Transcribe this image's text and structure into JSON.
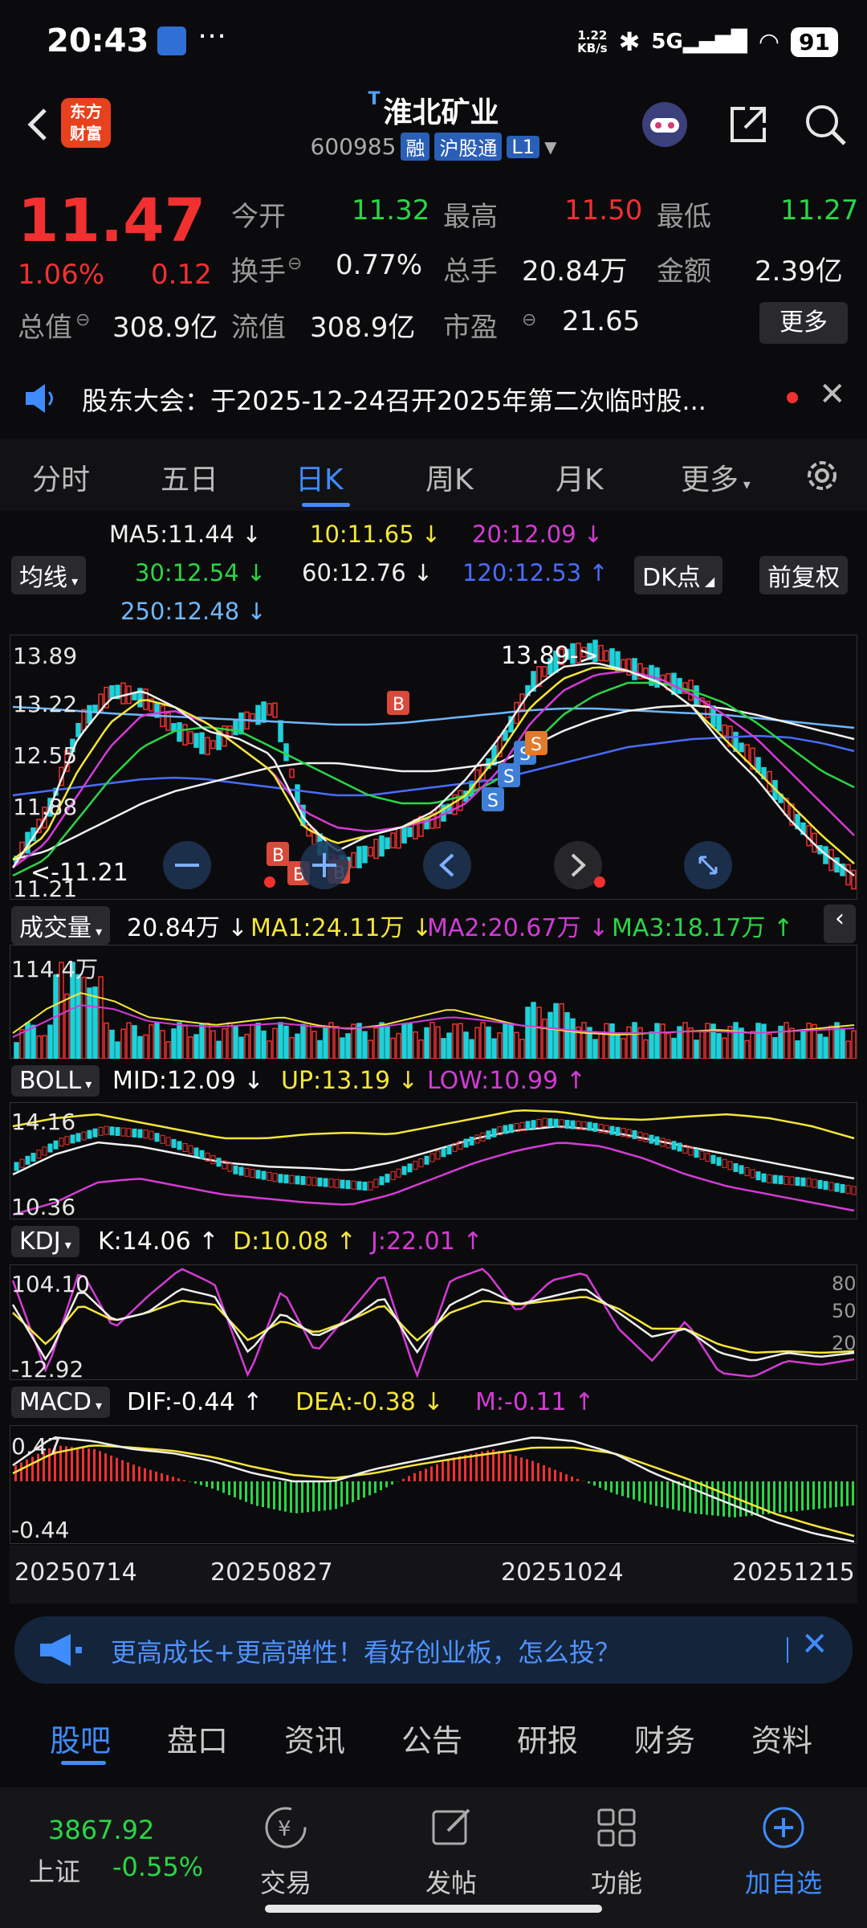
{
  "status_bar": {
    "time": "20:43",
    "net_speed_value": "1.22",
    "net_speed_unit": "KB/s",
    "network": "5G",
    "battery": "91"
  },
  "header": {
    "logo": "东方财富",
    "title": "淮北矿业",
    "title_prefix": "T",
    "code": "600985",
    "tags": [
      "融",
      "沪股通",
      "L1"
    ]
  },
  "quote": {
    "price": "11.47",
    "change_pct": "1.06%",
    "change": "0.12",
    "fields": [
      {
        "label": "今开",
        "value": "11.32",
        "color": "green"
      },
      {
        "label": "最高",
        "value": "11.50",
        "color": "red"
      },
      {
        "label": "最低",
        "value": "11.27",
        "color": "green"
      },
      {
        "label": "换手",
        "value": "0.77%",
        "color": "white"
      },
      {
        "label": "总手",
        "value": "20.84万",
        "color": "white"
      },
      {
        "label": "金额",
        "value": "2.39亿",
        "color": "white"
      },
      {
        "label": "总值",
        "value": "308.9亿",
        "color": "white"
      },
      {
        "label": "流值",
        "value": "308.9亿",
        "color": "white"
      },
      {
        "label": "市盈",
        "value": "21.65",
        "color": "white"
      }
    ],
    "more": "更多"
  },
  "notice": {
    "text": "股东大会：于2025-12-24召开2025年第二次临时股..."
  },
  "tabs": [
    "分时",
    "五日",
    "日K",
    "周K",
    "月K",
    "更多"
  ],
  "ma_legend": {
    "menu": "均线",
    "dk": "DK点",
    "fq": "前复权",
    "items": [
      {
        "text": "MA5:11.44 ↓",
        "color": "#f0f0f0"
      },
      {
        "text": "10:11.65 ↓",
        "color": "#f5e63a"
      },
      {
        "text": "20:12.09 ↓",
        "color": "#d43bd6"
      },
      {
        "text": "30:12.54 ↓",
        "color": "#2ad646"
      },
      {
        "text": "60:12.76 ↓",
        "color": "#f0f0f0"
      },
      {
        "text": "120:12.53 ↑",
        "color": "#4a6cff"
      },
      {
        "text": "250:12.48 ↓",
        "color": "#6fb7ff"
      }
    ]
  },
  "kline": {
    "y_ticks": [
      "13.89",
      "13.22",
      "12.55",
      "11.88",
      "11.21"
    ],
    "high_label": "13.89->",
    "low_label": "<-11.21",
    "b_marker": "B",
    "s_marker": "S"
  },
  "volume": {
    "menu": "成交量",
    "value": "20.84万 ↓",
    "ma1": "MA1:24.11万 ↓",
    "ma2": "MA2:20.67万 ↓",
    "ma3": "MA3:18.17万 ↑",
    "max_tick": "114.4万"
  },
  "boll": {
    "menu": "BOLL",
    "mid": "MID:12.09 ↓",
    "up": "UP:13.19 ↓",
    "low": "LOW:10.99 ↑",
    "ticks": [
      "14.16",
      "10.36"
    ]
  },
  "kdj": {
    "menu": "KDJ",
    "k": "K:14.06 ↑",
    "d": "D:10.08 ↑",
    "j": "J:22.01 ↑",
    "ticks": [
      "104.10",
      "-12.92"
    ],
    "right_ticks": [
      "80",
      "50",
      "20"
    ]
  },
  "macd": {
    "menu": "MACD",
    "dif": "DIF:-0.44 ↑",
    "dea": "DEA:-0.38 ↓",
    "m": "M:-0.11 ↑",
    "ticks": [
      "0.47",
      "-0.44"
    ]
  },
  "dates": [
    "20250714",
    "20250827",
    "20251024",
    "20251215"
  ],
  "banner": {
    "text": "更高成长+更高弹性！看好创业板，怎么投？"
  },
  "bottom_tabs": [
    "股吧",
    "盘口",
    "资讯",
    "公告",
    "研报",
    "财务",
    "资料"
  ],
  "bottom_bar": {
    "index_value": "3867.92",
    "index_name": "上证",
    "index_change": "-0.55%",
    "items": [
      "交易",
      "发帖",
      "功能",
      "加自选"
    ]
  },
  "colors": {
    "up": "#f23030",
    "down": "#2ad646",
    "accent": "#3f8cff"
  }
}
